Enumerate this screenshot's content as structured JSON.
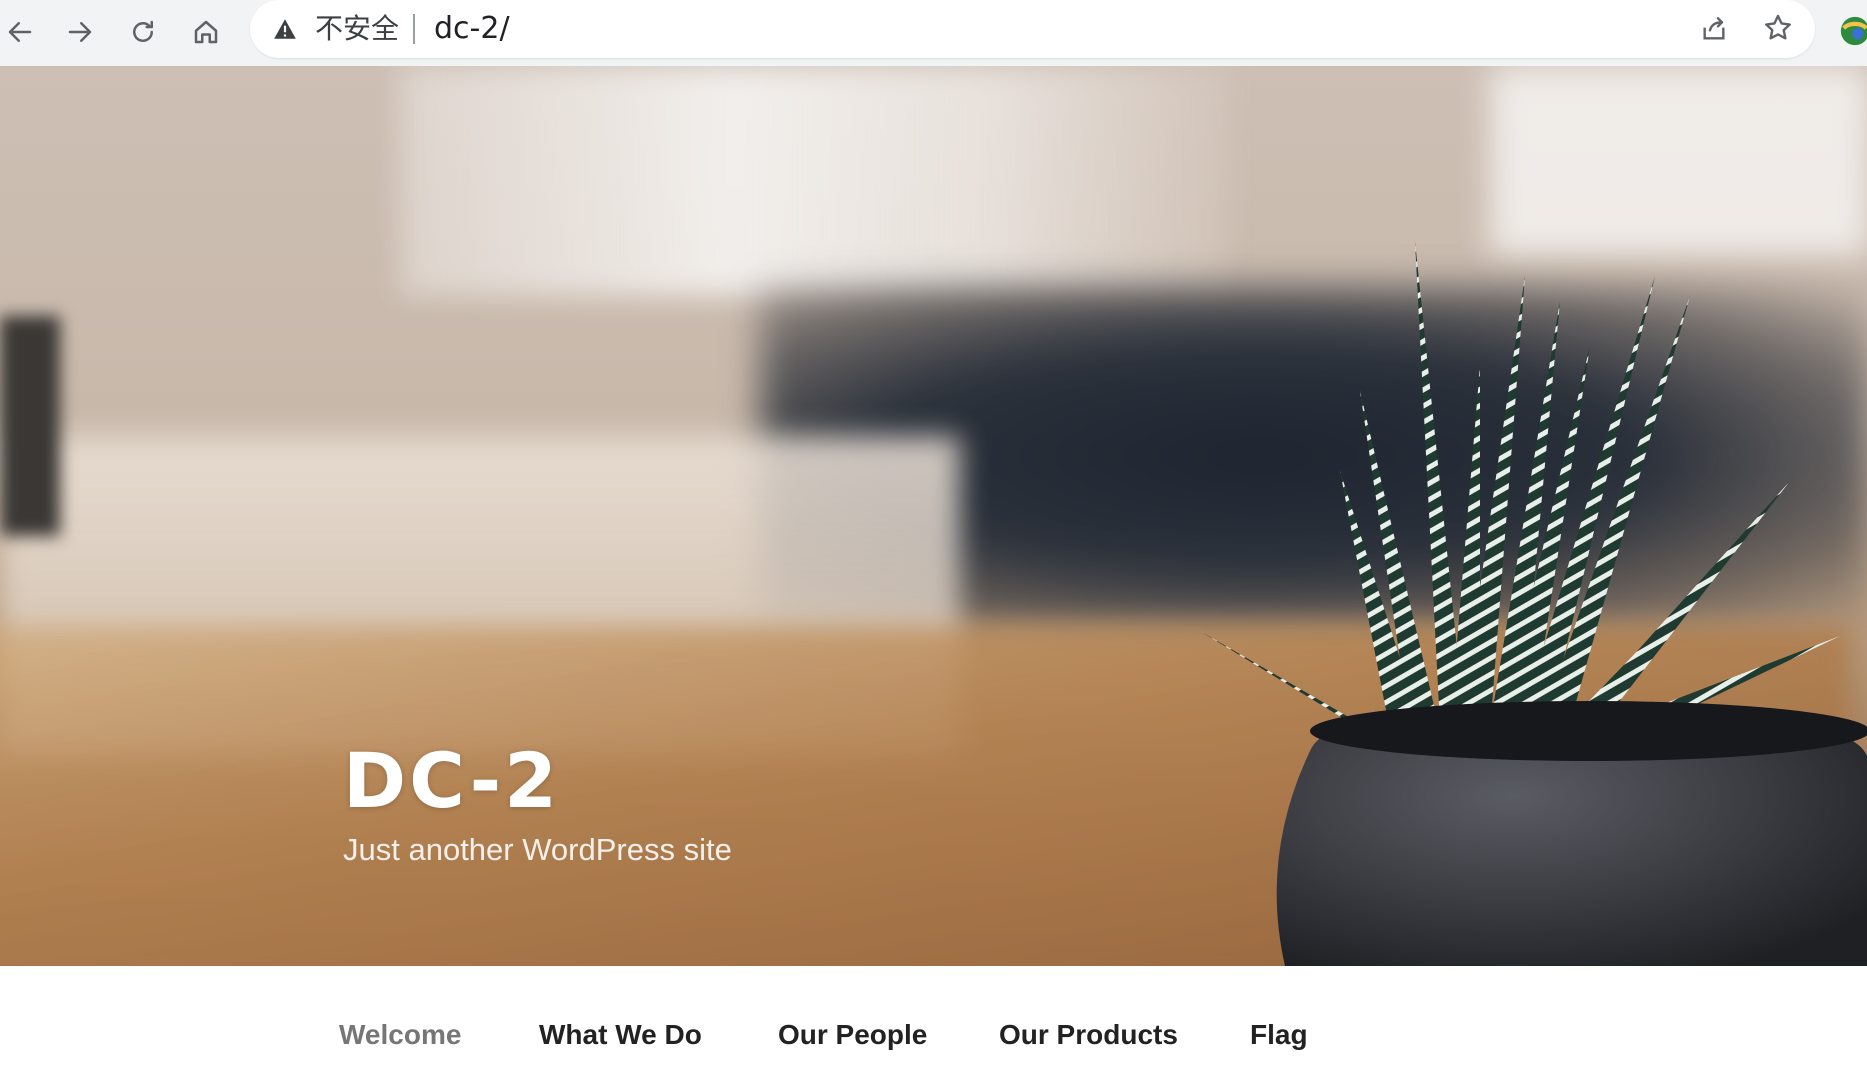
{
  "browser": {
    "security_label": "不安全",
    "url": "dc-2/",
    "icons": [
      "back-arrow-icon",
      "forward-arrow-icon",
      "reload-icon",
      "home-icon",
      "warning-icon",
      "share-icon",
      "star-icon",
      "extension-icon"
    ]
  },
  "site": {
    "title": "DC-2",
    "description": "Just another WordPress site"
  },
  "nav": {
    "items": [
      {
        "label": "Welcome",
        "current": true
      },
      {
        "label": "What We Do",
        "current": false
      },
      {
        "label": "Our People",
        "current": false
      },
      {
        "label": "Our Products",
        "current": false
      },
      {
        "label": "Flag",
        "current": false
      }
    ]
  },
  "colors": {
    "chrome_bg": "#f1f3f4",
    "nav_text": "#222222",
    "nav_current": "#767676",
    "title_text": "#ffffff"
  }
}
